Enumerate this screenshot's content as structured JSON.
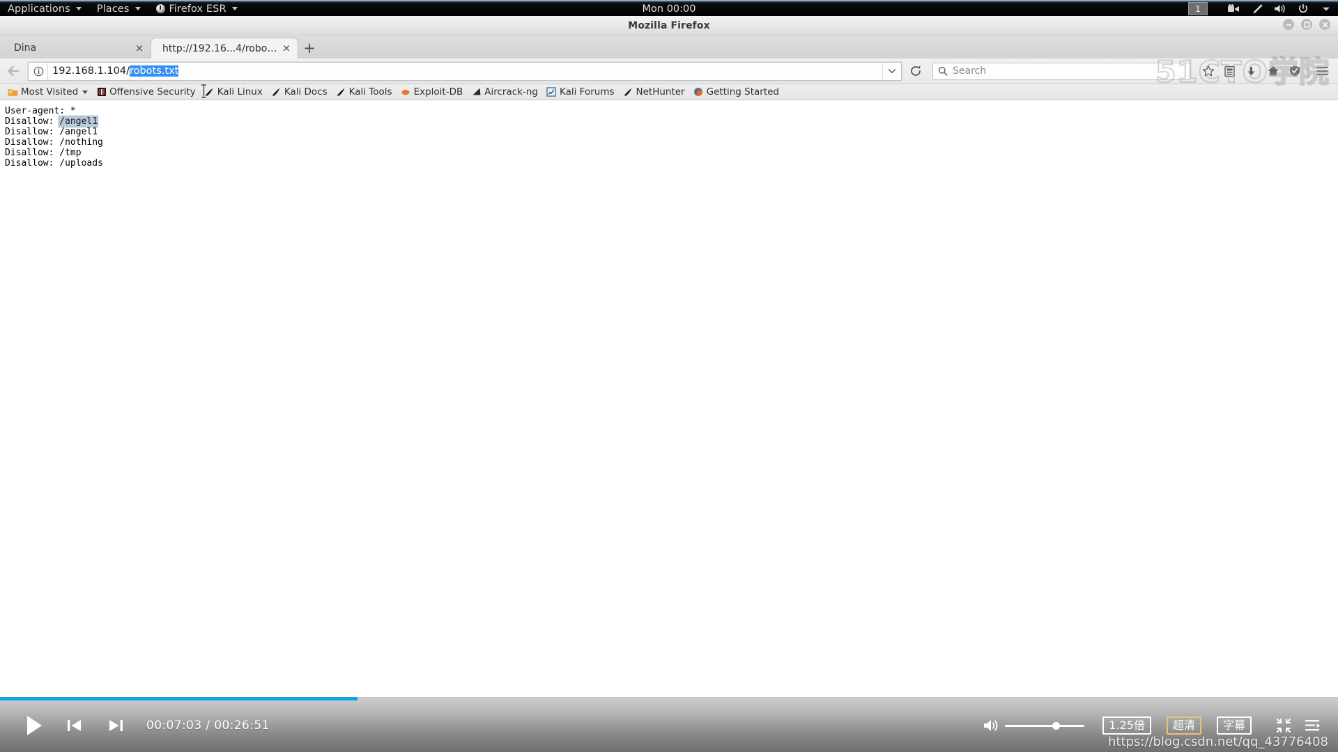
{
  "desktop": {
    "menus": [
      {
        "label": "Applications",
        "icon": "none",
        "caret": true
      },
      {
        "label": "Places",
        "icon": "none",
        "caret": true
      },
      {
        "label": "Firefox ESR",
        "icon": "firefox-icon",
        "caret": true
      }
    ],
    "clock": "Mon 00:00",
    "workspace": "1",
    "tray_icons": [
      "camera-icon",
      "pen-icon",
      "volume-icon",
      "power-icon",
      "chevron-down-icon"
    ]
  },
  "window": {
    "title": "Mozilla Firefox",
    "controls": [
      "minimize",
      "maximize",
      "close"
    ]
  },
  "tabs": [
    {
      "label": "Dina",
      "active": false,
      "close": "×"
    },
    {
      "label": "http://192.16...4/robots.txt",
      "active": true,
      "close": "×"
    }
  ],
  "new_tab_label": "+",
  "toolbar": {
    "back_icon": "back-arrow-icon",
    "identity_icon": "info-circle-icon",
    "url_prefix": "192.168.1.104/",
    "url_selected": "robots.txt",
    "url_full": "192.168.1.104/robots.txt",
    "dropdown_icon": "chevron-down-icon",
    "reload_icon": "reload-icon",
    "search_placeholder": "Search",
    "search_value": "",
    "right_icons": [
      "star-icon",
      "library-icon",
      "download-icon",
      "home-icon",
      "shield-icon",
      "hamburger-menu-icon"
    ]
  },
  "bookmarks": [
    {
      "label": "Most Visited",
      "icon": "folder-icon",
      "caret": true
    },
    {
      "label": "Offensive Security",
      "icon": "offsec-icon",
      "caret": false
    },
    {
      "label": "Kali Linux",
      "icon": "dragon-icon",
      "caret": false
    },
    {
      "label": "Kali Docs",
      "icon": "dragon-icon",
      "caret": false
    },
    {
      "label": "Kali Tools",
      "icon": "dragon-icon",
      "caret": false
    },
    {
      "label": "Exploit-DB",
      "icon": "exploitdb-icon",
      "caret": false
    },
    {
      "label": "Aircrack-ng",
      "icon": "aircrack-icon",
      "caret": false
    },
    {
      "label": "Kali Forums",
      "icon": "forums-icon",
      "caret": false
    },
    {
      "label": "NetHunter",
      "icon": "dragon-icon",
      "caret": false
    },
    {
      "label": "Getting Started",
      "icon": "firefox-icon",
      "caret": false
    }
  ],
  "page_content": {
    "lines": [
      {
        "text": "User-agent: *",
        "selected": null
      },
      {
        "prefix": "Disallow: ",
        "selected": "/angel1",
        "text": "Disallow: /angel1"
      },
      {
        "text": "Disallow: /angel1",
        "selected": null
      },
      {
        "text": "Disallow: /nothing",
        "selected": null
      },
      {
        "text": "Disallow: /tmp",
        "selected": null
      },
      {
        "text": "Disallow: /uploads",
        "selected": null
      }
    ]
  },
  "watermarks": {
    "top_right": "51CTO学院",
    "bottom_right": "https://blog.csdn.net/qq_43776408"
  },
  "player": {
    "progress_percent": 26.7,
    "progress_color": "#12a3e8",
    "play_icon": "play-icon",
    "prev_icon": "previous-icon",
    "next_icon": "next-icon",
    "time_current": "00:07:03",
    "time_total": "00:26:51",
    "time_display": "00:07:03 / 00:26:51",
    "volume_icon": "volume-icon",
    "volume_percent": 64,
    "speed_label": "1.25倍",
    "quality_label": "超清",
    "quality_highlight_color": "#f0c070",
    "subtitle_label": "字幕",
    "fullscreen_icon": "exit-fullscreen-icon",
    "playlist_icon": "playlist-icon"
  }
}
